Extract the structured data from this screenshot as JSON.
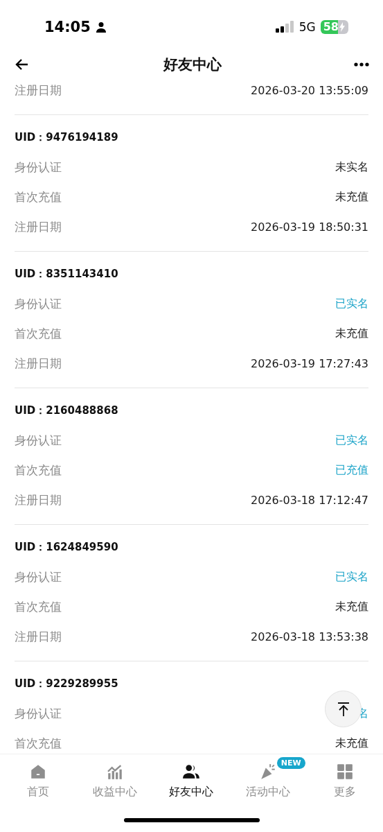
{
  "status_bar": {
    "time": "14:05",
    "network": "5G",
    "battery": "58"
  },
  "header": {
    "title": "好友中心"
  },
  "cards": [
    {
      "rows": [
        {
          "label": "注册日期",
          "value": "2026-03-20 13:55:09",
          "highlighted": false
        }
      ]
    },
    {
      "uid": "UID：9476194189",
      "rows": [
        {
          "label": "身份认证",
          "value": "未实名",
          "highlighted": false
        },
        {
          "label": "首次充值",
          "value": "未充值",
          "highlighted": false
        },
        {
          "label": "注册日期",
          "value": "2026-03-19 18:50:31",
          "highlighted": false
        }
      ]
    },
    {
      "uid": "UID：8351143410",
      "rows": [
        {
          "label": "身份认证",
          "value": "已实名",
          "highlighted": true
        },
        {
          "label": "首次充值",
          "value": "未充值",
          "highlighted": false
        },
        {
          "label": "注册日期",
          "value": "2026-03-19 17:27:43",
          "highlighted": false
        }
      ]
    },
    {
      "uid": "UID：2160488868",
      "rows": [
        {
          "label": "身份认证",
          "value": "已实名",
          "highlighted": true
        },
        {
          "label": "首次充值",
          "value": "已充值",
          "highlighted": true
        },
        {
          "label": "注册日期",
          "value": "2026-03-18 17:12:47",
          "highlighted": false
        }
      ]
    },
    {
      "uid": "UID：1624849590",
      "rows": [
        {
          "label": "身份认证",
          "value": "已实名",
          "highlighted": true
        },
        {
          "label": "首次充值",
          "value": "未充值",
          "highlighted": false
        },
        {
          "label": "注册日期",
          "value": "2026-03-18 13:53:38",
          "highlighted": false
        }
      ]
    },
    {
      "uid": "UID：9229289955",
      "rows": [
        {
          "label": "身份认证",
          "value": "名",
          "highlighted": true
        },
        {
          "label": "首次充值",
          "value": "未充值",
          "highlighted": false
        }
      ]
    }
  ],
  "nav": [
    {
      "label": "首页",
      "selected": false
    },
    {
      "label": "收益中心",
      "selected": false
    },
    {
      "label": "好友中心",
      "selected": true
    },
    {
      "label": "活动中心",
      "selected": false,
      "badge": "NEW"
    },
    {
      "label": "更多",
      "selected": false
    }
  ]
}
